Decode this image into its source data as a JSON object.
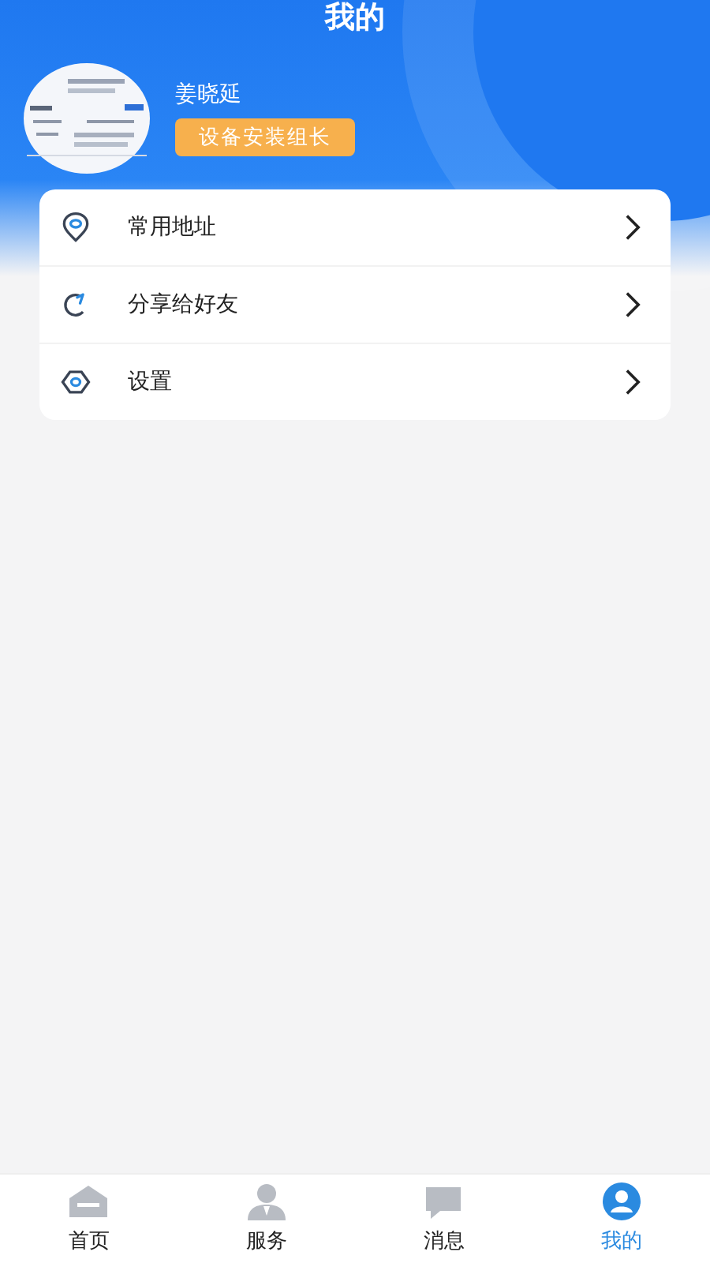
{
  "header": {
    "title": "我的"
  },
  "profile": {
    "name": "姜晓延",
    "role": "设备安装组长"
  },
  "menu": [
    {
      "kind": "location",
      "label": "常用地址"
    },
    {
      "kind": "share",
      "label": "分享给好友"
    },
    {
      "kind": "settings",
      "label": "设置"
    }
  ],
  "tabs": [
    {
      "kind": "home",
      "label": "首页",
      "selected": false
    },
    {
      "kind": "service",
      "label": "服务",
      "selected": false
    },
    {
      "kind": "message",
      "label": "消息",
      "selected": false
    },
    {
      "kind": "mine",
      "label": "我的",
      "selected": true
    }
  ]
}
